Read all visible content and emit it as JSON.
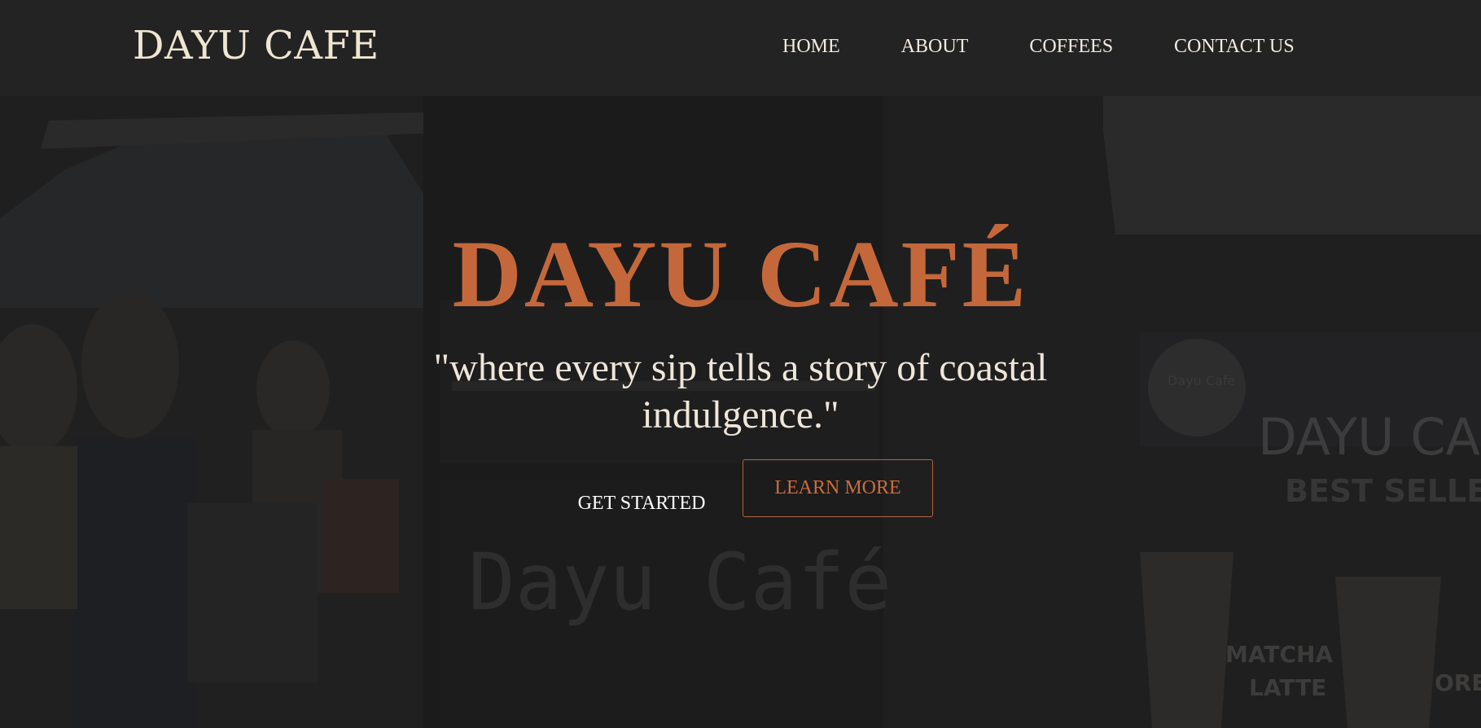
{
  "header": {
    "brand": "DAYU CAFE",
    "nav": [
      {
        "label": "HOME"
      },
      {
        "label": "ABOUT"
      },
      {
        "label": "COFFEES"
      },
      {
        "label": "CONTACT US"
      }
    ]
  },
  "hero": {
    "title": "DAYU CAFÉ",
    "tagline": "\"where every sip tells a story of coastal indulgence.\"",
    "get_started_label": "GET STARTED",
    "learn_more_label": "LEARN MORE",
    "background_signage": {
      "counter_sign": "Dayu Café",
      "board_title": "DAYU CAF",
      "board_subtitle": "BEST SELLER",
      "logo_text": "Dayu Cafe",
      "cup_label_1": "MATCHA",
      "cup_label_2": "LATTE",
      "cup_label_3": "ORE"
    }
  },
  "colors": {
    "accent": "#c4683b",
    "header_bg": "#232323",
    "text_light": "#efe6da"
  }
}
